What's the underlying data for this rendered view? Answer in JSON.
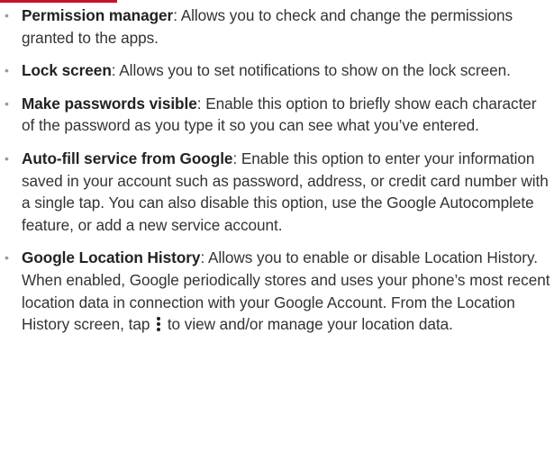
{
  "items": [
    {
      "term": "Permission manager",
      "description": ": Allows you to check and change the permissions granted to the apps."
    },
    {
      "term": "Lock screen",
      "description": ": Allows you to set notifications to show on the lock screen."
    },
    {
      "term": "Make passwords visible",
      "description": ": Enable this option to briefly show each character of the password as you type it so you can see what you’ve entered."
    },
    {
      "term": "Auto-fill service from Google",
      "description": ": Enable this option to enter your information saved in your account such as password, address, or credit card number with a single tap. You can also disable this option, use the Google Autocomplete feature, or add a new service account."
    },
    {
      "term": "Google Location History",
      "description": ": Allows you to enable or disable Location History. When enabled, Google periodically stores and uses your phone’s most recent location data in connection with your Google Account. From the Location History screen, tap",
      "icon": "more-vert-icon",
      "description_after_icon": "to view and/or manage your location data."
    }
  ],
  "bullet_symbol": "•",
  "colors": {
    "accent": "#c8102e",
    "text": "#333333",
    "term": "#222222",
    "bullet": "#9a9a9a"
  }
}
